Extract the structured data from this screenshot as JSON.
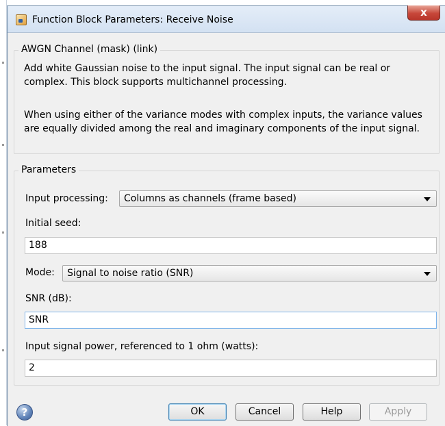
{
  "window": {
    "title": "Function Block Parameters: Receive Noise",
    "close_glyph": "x"
  },
  "description": {
    "legend": "AWGN Channel (mask) (link)",
    "paragraph1": "Add white Gaussian noise to the input signal. The input signal can be real or complex. This block supports multichannel processing.",
    "paragraph2": "When using either of the variance modes with complex inputs, the variance values are equally divided among the real and imaginary components of the input signal."
  },
  "parameters": {
    "legend": "Parameters",
    "input_processing": {
      "label": "Input processing:",
      "value": "Columns as channels (frame based)"
    },
    "initial_seed": {
      "label": "Initial seed:",
      "value": "188"
    },
    "mode": {
      "label": "Mode:",
      "value": "Signal to noise ratio  (SNR)"
    },
    "snr": {
      "label": "SNR (dB):",
      "value": "SNR"
    },
    "input_signal_power": {
      "label": "Input signal power, referenced to 1 ohm (watts):",
      "value": "2"
    }
  },
  "buttons": {
    "help_icon_glyph": "?",
    "ok": "OK",
    "cancel": "Cancel",
    "help": "Help",
    "apply": "Apply"
  },
  "icons": {
    "window": "simulink-block-icon",
    "help": "question-circle-icon",
    "dropdown": "chevron-down-icon"
  }
}
